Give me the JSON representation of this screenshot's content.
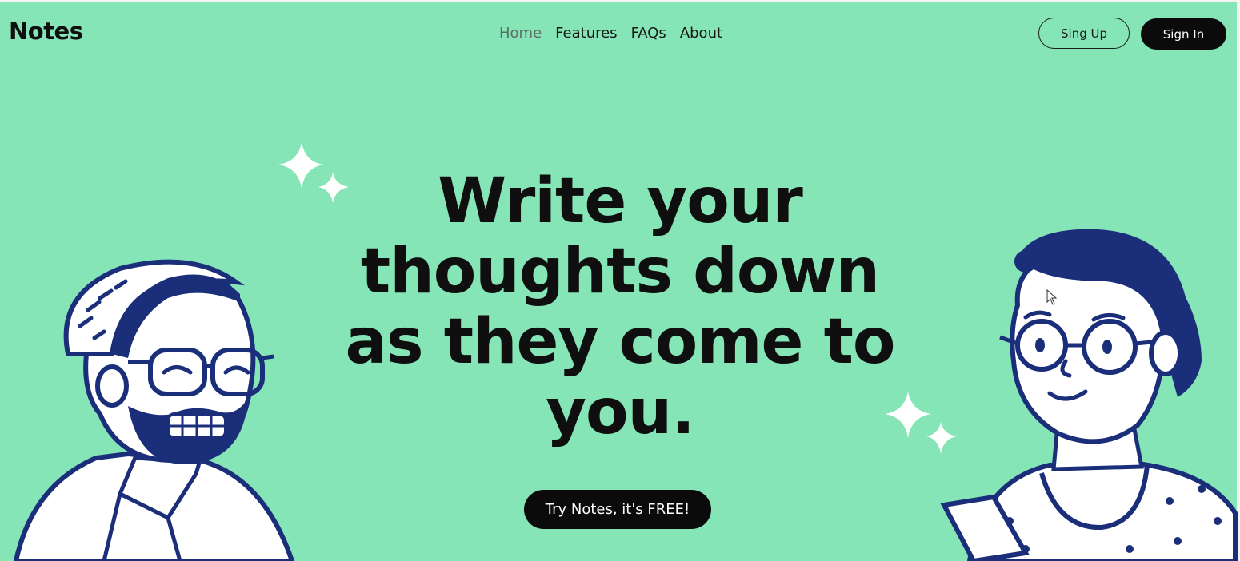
{
  "brand": {
    "name": "Notes"
  },
  "nav": {
    "items": [
      {
        "label": "Home",
        "active": true
      },
      {
        "label": "Features",
        "active": false
      },
      {
        "label": "FAQs",
        "active": false
      },
      {
        "label": "About",
        "active": false
      }
    ]
  },
  "auth": {
    "signup_label": "Sing Up",
    "signin_label": "Sign In"
  },
  "hero": {
    "headline_lines": [
      "Write your",
      "thoughts down",
      "as they come to",
      "you."
    ],
    "cta_label": "Try Notes, it's FREE!"
  },
  "icons": {
    "sparkles": "sparkle-icon",
    "cursor": "mouse-pointer-icon"
  },
  "colors": {
    "background": "#86e5b7",
    "text": "#0f0f0f",
    "button_dark": "#0b0b0b",
    "illustration_blue": "#1a2e7a",
    "sparkle": "#ffffff"
  }
}
